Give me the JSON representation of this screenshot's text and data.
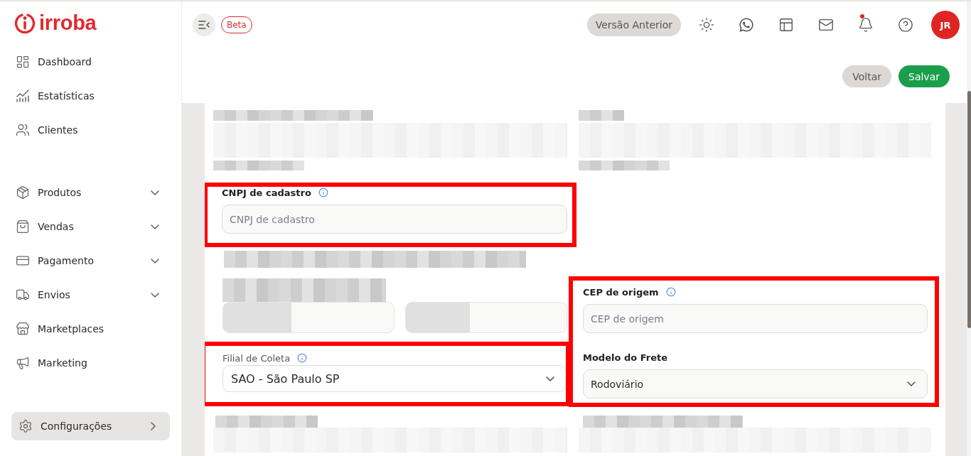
{
  "sidebar": {
    "logo": "irroba",
    "sections": [
      [
        {
          "label": "Dashboard",
          "kind": "link",
          "selected": false
        },
        {
          "label": "Estatísticas",
          "kind": "link",
          "selected": false
        },
        {
          "label": "Clientes",
          "kind": "link",
          "selected": false
        }
      ],
      [
        {
          "label": "Produtos",
          "kind": "group",
          "selected": false
        },
        {
          "label": "Vendas",
          "kind": "group",
          "selected": false
        },
        {
          "label": "Pagamento",
          "kind": "group",
          "selected": false
        },
        {
          "label": "Envios",
          "kind": "group",
          "selected": false
        },
        {
          "label": "Marketplaces",
          "kind": "link",
          "selected": false
        },
        {
          "label": "Marketing",
          "kind": "link",
          "selected": false
        }
      ]
    ],
    "footer_item": {
      "label": "Configurações",
      "kind": "page",
      "selected": true
    }
  },
  "topbar": {
    "badge": "Beta",
    "previous_version_button": "Versão Anterior",
    "notification_dot": true,
    "avatar_initials": "JR"
  },
  "actions": [
    {
      "label": "Voltar",
      "kind": "secondary"
    },
    {
      "label": "Salvar",
      "kind": "primary"
    }
  ],
  "form": {
    "cnpj_field": {
      "label": "CNPJ de cadastro",
      "info": true,
      "placeholder": "CNPJ de cadastro",
      "highlighted": true
    },
    "origin_group": {
      "highlighted": true,
      "fields": [
        {
          "kind": "input",
          "label": "CEP de origem",
          "info": true,
          "placeholder": "CEP de origem"
        },
        {
          "kind": "select",
          "label": "Modelo do Frete",
          "info": false,
          "value": "Rodoviário"
        }
      ]
    },
    "branch_field": {
      "label": "Filial de Coleta",
      "info": true,
      "value": "SAO - São Paulo SP",
      "highlighted": true
    }
  }
}
